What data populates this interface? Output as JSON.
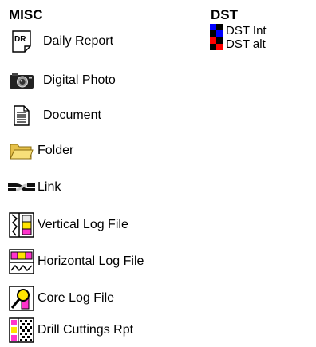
{
  "misc": {
    "title": "MISC",
    "items": [
      {
        "label": "Daily Report",
        "icon": "daily-report-icon"
      },
      {
        "label": "Digital Photo",
        "icon": "camera-icon"
      },
      {
        "label": "Document",
        "icon": "document-icon"
      },
      {
        "label": "Folder",
        "icon": "folder-icon"
      },
      {
        "label": "Link",
        "icon": "link-icon"
      },
      {
        "label": "Vertical Log File",
        "icon": "vertical-log-icon"
      },
      {
        "label": "Horizontal Log File",
        "icon": "horizontal-log-icon"
      },
      {
        "label": "Core Log File",
        "icon": "core-log-icon"
      },
      {
        "label": "Drill Cuttings Rpt",
        "icon": "drill-cuttings-icon"
      }
    ]
  },
  "dst": {
    "title": "DST",
    "items": [
      {
        "label": "DST Int",
        "icon": "dst-int-icon"
      },
      {
        "label": "DST alt",
        "icon": "dst-alt-icon"
      }
    ]
  },
  "daily_report_icon_text": "DR"
}
